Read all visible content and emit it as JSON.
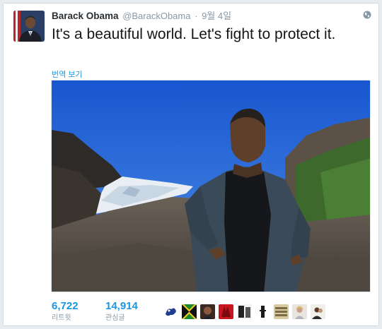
{
  "tweet": {
    "display_name": "Barack Obama",
    "handle": "@BarackObama",
    "separator": "·",
    "timestamp": "9월 4일",
    "text": "It's a beautiful world. Let's fight to protect it.",
    "translate_label": "번역 보기"
  },
  "stats": {
    "retweets_value": "6,722",
    "retweets_label": "리트윗",
    "likes_value": "14,914",
    "likes_label": "관심글"
  },
  "icons": {
    "globe": "globe-icon"
  },
  "colors": {
    "link": "#1b95e0",
    "muted": "#8899a6",
    "sky": "#1f61d8"
  },
  "liked_by_avatars": [
    "avatar-1",
    "avatar-2",
    "avatar-3",
    "avatar-4",
    "avatar-5",
    "avatar-6",
    "avatar-7",
    "avatar-8",
    "avatar-9"
  ]
}
